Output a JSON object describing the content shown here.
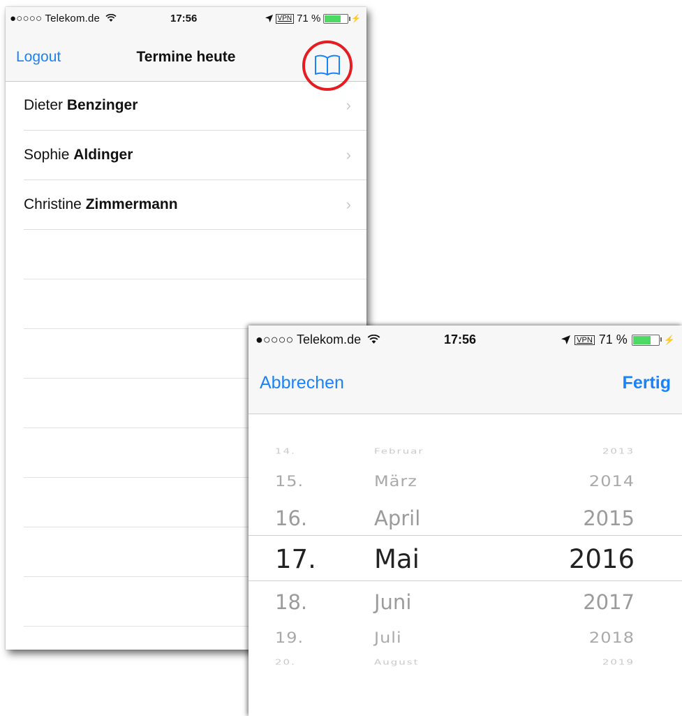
{
  "screen1": {
    "status": {
      "carrier": "●○○○○ Telekom.de",
      "time": "17:56",
      "vpn": "VPN",
      "battery": "71 %",
      "battery_level": 0.71
    },
    "nav": {
      "logout": "Logout",
      "title": "Termine heute",
      "book_icon": "book-icon"
    },
    "rows": [
      {
        "first": "Dieter",
        "last": "Benzinger"
      },
      {
        "first": "Sophie",
        "last": "Aldinger"
      },
      {
        "first": "Christine",
        "last": "Zimmermann"
      }
    ],
    "chevron": "›",
    "colors": {
      "accent": "#1a82fb",
      "highlight_circle": "#e51d22"
    }
  },
  "screen2": {
    "status": {
      "carrier": "●○○○○ Telekom.de",
      "time": "17:56",
      "vpn": "VPN",
      "battery": "71 %",
      "battery_level": 0.71
    },
    "nav": {
      "cancel": "Abbrechen",
      "done": "Fertig"
    },
    "picker": {
      "days": [
        "14.",
        "15.",
        "16.",
        "17.",
        "18.",
        "19.",
        "20."
      ],
      "months": [
        "Februar",
        "März",
        "April",
        "Mai",
        "Juni",
        "Juli",
        "August"
      ],
      "years": [
        "2013",
        "2014",
        "2015",
        "2016",
        "2017",
        "2018",
        "2019"
      ],
      "selected": {
        "day": "17.",
        "month": "Mai",
        "year": "2016"
      }
    }
  }
}
